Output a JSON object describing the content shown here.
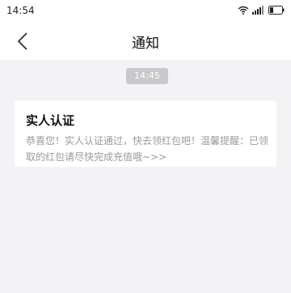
{
  "status_bar": {
    "time": "14:54",
    "icons": [
      "wifi-icon",
      "signal-icon",
      "battery-icon"
    ]
  },
  "header": {
    "title": "通知",
    "back_icon": "chevron-left-icon"
  },
  "message": {
    "timestamp": "14:45",
    "title": "实人认证",
    "body": "恭喜您！实人认证通过，快去领红包吧！温馨提醒：已领取的红包请尽快完成充值哦~>>"
  }
}
